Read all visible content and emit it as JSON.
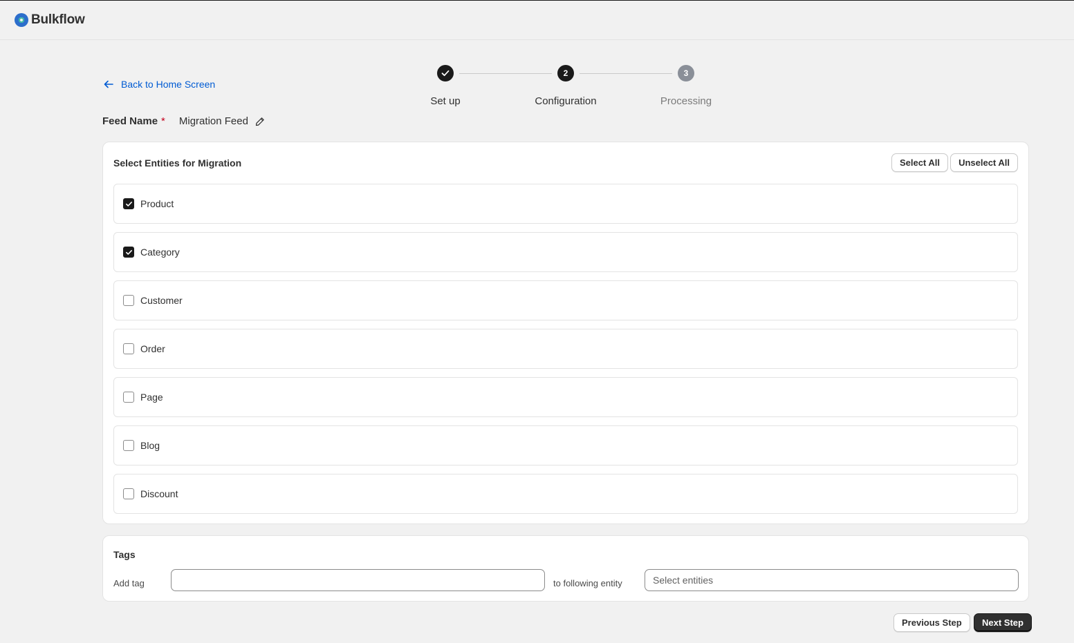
{
  "app": {
    "name": "Bulkflow"
  },
  "nav": {
    "back_label": "Back to Home Screen"
  },
  "stepper": {
    "steps": [
      {
        "label": "Set up",
        "number": "",
        "status": "done"
      },
      {
        "label": "Configuration",
        "number": "2",
        "status": "active"
      },
      {
        "label": "Processing",
        "number": "3",
        "status": "pending"
      }
    ]
  },
  "feed": {
    "label": "Feed Name",
    "required_mark": "*",
    "value": "Migration Feed"
  },
  "entities": {
    "title": "Select Entities for Migration",
    "select_all_label": "Select All",
    "unselect_all_label": "Unselect All",
    "items": [
      {
        "label": "Product",
        "checked": true
      },
      {
        "label": "Category",
        "checked": true
      },
      {
        "label": "Customer",
        "checked": false
      },
      {
        "label": "Order",
        "checked": false
      },
      {
        "label": "Page",
        "checked": false
      },
      {
        "label": "Blog",
        "checked": false
      },
      {
        "label": "Discount",
        "checked": false
      }
    ]
  },
  "tags": {
    "title": "Tags",
    "add_tag_label": "Add tag",
    "tag_value": "",
    "connector_label": "to following entity",
    "entity_select_placeholder": "Select entities"
  },
  "footer": {
    "previous_label": "Previous Step",
    "next_label": "Next Step"
  },
  "colors": {
    "link": "#005bd3",
    "primary_button": "#303030",
    "required": "#c4001d"
  }
}
